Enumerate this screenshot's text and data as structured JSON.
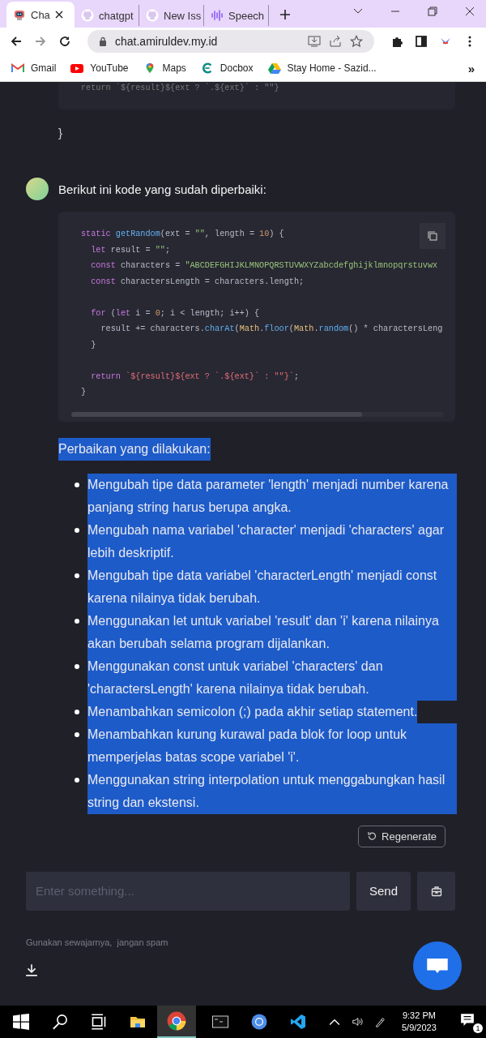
{
  "browser": {
    "tabs": [
      {
        "title": "Cha",
        "selected": true
      },
      {
        "title": "chatgpt",
        "selected": false
      },
      {
        "title": "New Iss",
        "selected": false
      },
      {
        "title": "Speech",
        "selected": false
      }
    ],
    "url": "chat.amiruldev.my.id",
    "bookmarks": [
      {
        "label": "Gmail"
      },
      {
        "label": "YouTube"
      },
      {
        "label": "Maps"
      },
      {
        "label": "Docbox"
      },
      {
        "label": "Stay Home - Sazid..."
      }
    ],
    "bookmarks_overflow": "»"
  },
  "chat": {
    "previous_code_tail": "return `${result}${ext ? `.${ext}` : \"\"}",
    "previous_closing": "}",
    "message": {
      "intro": "Berikut ini kode yang sudah diperbaiki:",
      "code": [
        {
          "kind": "code",
          "tokens": [
            {
              "kind": "kw",
              "text": "static"
            },
            {
              "kind": "fn",
              "text": " getRandom"
            },
            {
              "kind": "plain",
              "text": "(ext = "
            },
            {
              "kind": "str",
              "text": "\"\""
            },
            {
              "kind": "plain",
              "text": ", length = "
            },
            {
              "kind": "num",
              "text": "10"
            },
            {
              "kind": "plain",
              "text": ") {"
            }
          ]
        },
        {
          "kind": "code",
          "tokens": [
            {
              "kind": "kw",
              "text": "  let"
            },
            {
              "kind": "plain",
              "text": " result = "
            },
            {
              "kind": "str",
              "text": "\"\""
            },
            {
              "kind": "plain",
              "text": ";"
            }
          ]
        },
        {
          "kind": "code",
          "tokens": [
            {
              "kind": "kw",
              "text": "  const"
            },
            {
              "kind": "plain",
              "text": " characters = "
            },
            {
              "kind": "str",
              "text": "\"ABCDEFGHIJKLMNOPQRSTUVWXYZabcdefghijklmnopqrstuvwx"
            }
          ]
        },
        {
          "kind": "code",
          "tokens": [
            {
              "kind": "kw",
              "text": "  const"
            },
            {
              "kind": "plain",
              "text": " charactersLength = characters.length;"
            }
          ]
        },
        {
          "kind": "blank"
        },
        {
          "kind": "code",
          "tokens": [
            {
              "kind": "kw",
              "text": "  for"
            },
            {
              "kind": "plain",
              "text": " ("
            },
            {
              "kind": "kw",
              "text": "let"
            },
            {
              "kind": "plain",
              "text": " i = "
            },
            {
              "kind": "num",
              "text": "0"
            },
            {
              "kind": "plain",
              "text": "; i < length; i++) {"
            }
          ]
        },
        {
          "kind": "code",
          "tokens": [
            {
              "kind": "plain",
              "text": "    result += characters."
            },
            {
              "kind": "fn",
              "text": "charAt"
            },
            {
              "kind": "plain",
              "text": "("
            },
            {
              "kind": "cls",
              "text": "Math"
            },
            {
              "kind": "plain",
              "text": "."
            },
            {
              "kind": "fn",
              "text": "floor"
            },
            {
              "kind": "plain",
              "text": "("
            },
            {
              "kind": "cls",
              "text": "Math"
            },
            {
              "kind": "plain",
              "text": "."
            },
            {
              "kind": "fn",
              "text": "random"
            },
            {
              "kind": "plain",
              "text": "() * charactersLeng"
            }
          ]
        },
        {
          "kind": "code",
          "tokens": [
            {
              "kind": "plain",
              "text": "  }"
            }
          ]
        },
        {
          "kind": "blank"
        },
        {
          "kind": "code",
          "tokens": [
            {
              "kind": "kw",
              "text": "  return"
            },
            {
              "kind": "tpl",
              "text": " `${result}${ext ? `.${ext}` : \"\"}`"
            },
            {
              "kind": "plain",
              "text": ";"
            }
          ]
        },
        {
          "kind": "code",
          "tokens": [
            {
              "kind": "plain",
              "text": "}"
            }
          ]
        }
      ],
      "text_selected": true,
      "heading": "Perbaikan yang dilakukan:",
      "items": [
        "Mengubah tipe data parameter 'length' menjadi number karena panjang string harus berupa angka.",
        "Mengubah nama variabel 'character' menjadi 'characters' agar lebih deskriptif.",
        "Mengubah tipe data variabel 'characterLength' menjadi const karena nilainya tidak berubah.",
        "Menggunakan let untuk variabel 'result' dan 'i' karena nilainya akan berubah selama program dijalankan.",
        "Menggunakan const untuk variabel 'characters' dan 'charactersLength' karena nilainya tidak berubah.",
        "Menambahkan semicolon (;) pada akhir setiap statement.",
        "Menambahkan kurung kurawal pada blok for loop untuk memperjelas batas scope variabel 'i'.",
        "Menggunakan string interpolation untuk menggabungkan hasil string dan ekstensi."
      ]
    },
    "regenerate": "Regenerate",
    "input": {
      "placeholder": "Enter something..."
    },
    "send": "Send",
    "footer": "Gunakan sewajarnya,  jangan spam"
  },
  "taskbar": {
    "time": "9:32 PM",
    "date": "5/9/2023",
    "notifications": "1"
  }
}
